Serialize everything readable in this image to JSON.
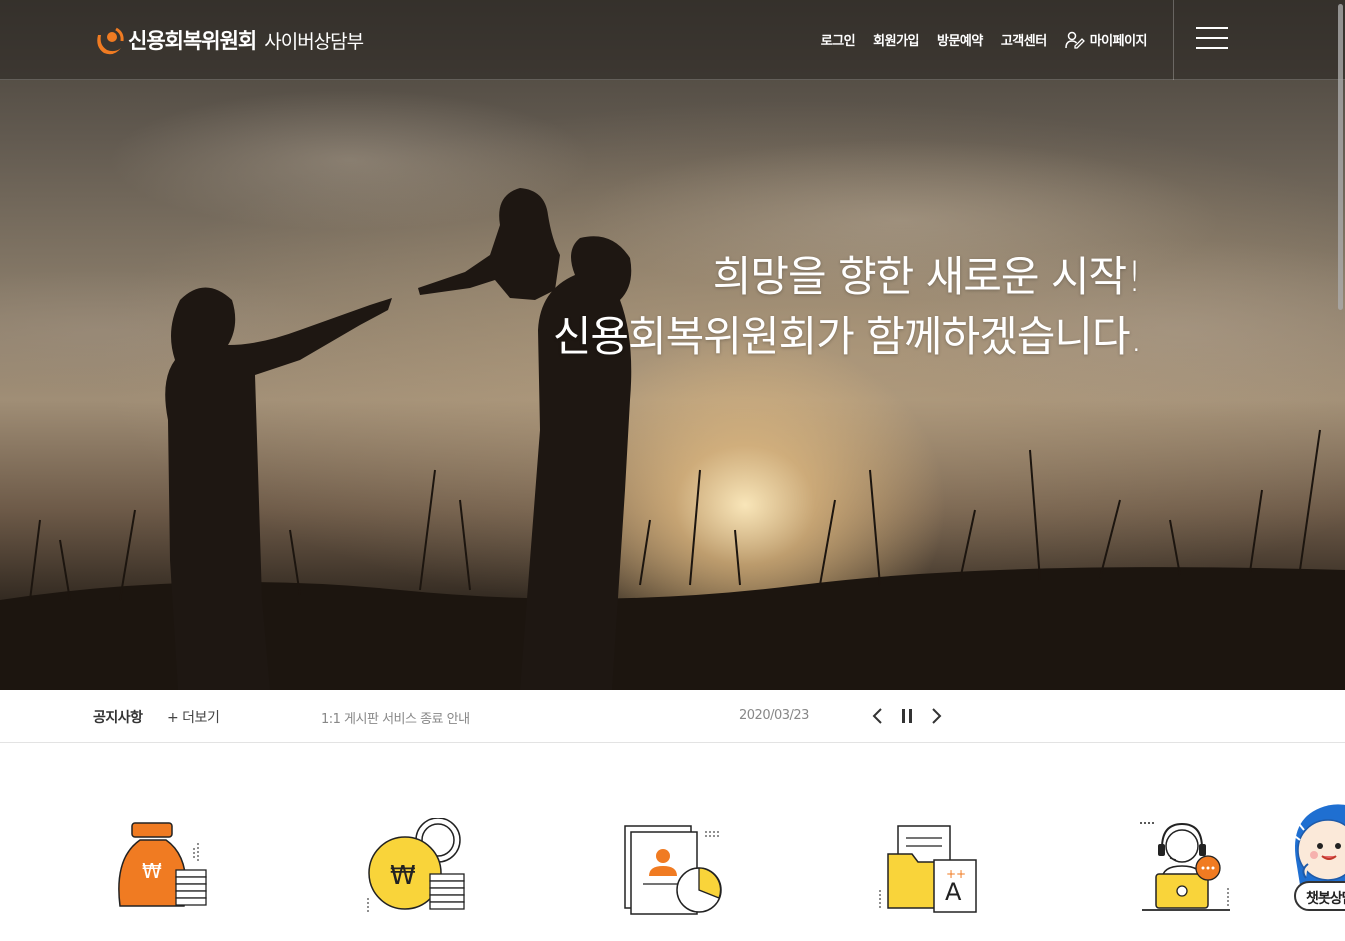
{
  "header": {
    "logo_name": "신용회복위원회",
    "logo_sub": "사이버상담부",
    "nav": {
      "login": "로그인",
      "signup": "회원가입",
      "reservation": "방문예약",
      "customer_center": "고객센터",
      "mypage": "마이페이지"
    }
  },
  "hero": {
    "line1": "희망을 향한 새로운 시작!",
    "line2": "신용회복위원회가 함께하겠습니다."
  },
  "notice": {
    "label": "공지사항",
    "more": "+ 더보기",
    "title": "1:1 게시판 서비스 종료 안내",
    "date": "2020/03/23"
  },
  "chatbot": {
    "label": "챗봇상담"
  },
  "colors": {
    "accent_orange": "#f07b22",
    "icon_yellow": "#f9d43a",
    "line_dark": "#222222"
  },
  "icons": [
    "money-bag-icon",
    "coin-stack-icon",
    "document-chart-icon",
    "folder-document-icon",
    "counselor-laptop-icon"
  ]
}
